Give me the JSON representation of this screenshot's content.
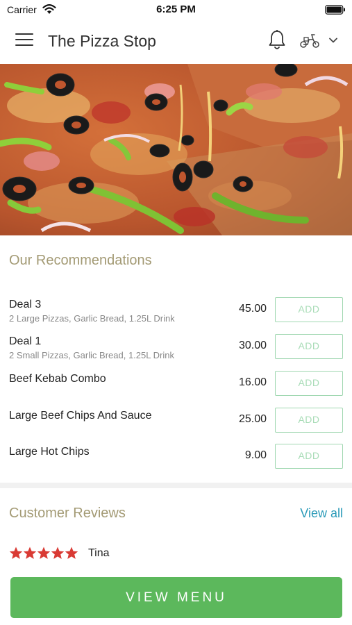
{
  "status_bar": {
    "carrier": "Carrier",
    "time": "6:25 PM"
  },
  "header": {
    "title": "The Pizza Stop",
    "icons": [
      "menu-icon",
      "bell-icon",
      "scooter-icon",
      "chevron-down-icon"
    ]
  },
  "hero": {
    "image_description_icon": "pizza-photo"
  },
  "recommendations": {
    "title": "Our Recommendations",
    "add_label": "ADD",
    "items": [
      {
        "name": "Deal 3",
        "description": "2 Large Pizzas, Garlic Bread, 1.25L Drink",
        "price": "45.00"
      },
      {
        "name": "Deal 1",
        "description": "2 Small Pizzas, Garlic Bread, 1.25L Drink",
        "price": "30.00"
      },
      {
        "name": "Beef Kebab Combo",
        "description": "",
        "price": "16.00"
      },
      {
        "name": "Large Beef Chips And Sauce",
        "description": "",
        "price": "25.00"
      },
      {
        "name": "Large Hot Chips",
        "description": "",
        "price": "9.00"
      }
    ]
  },
  "reviews": {
    "title": "Customer Reviews",
    "view_all": "View all",
    "latest": {
      "rating": 5,
      "name": "Tina"
    }
  },
  "footer": {
    "view_menu": "VIEW MENU"
  },
  "colors": {
    "accent_green": "#5cb85c",
    "add_border": "#9fd7b0",
    "section_title": "#a39a74",
    "link": "#2a9ab8",
    "star": "#d93a34"
  }
}
